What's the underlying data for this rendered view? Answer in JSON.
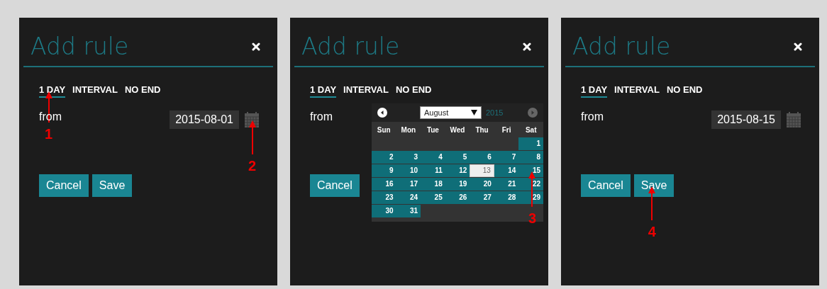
{
  "panels": [
    {
      "title": "Add rule",
      "tabs": [
        {
          "label": "1 DAY",
          "selected": true,
          "annotation": "1"
        },
        {
          "label": "INTERVAL",
          "selected": false
        },
        {
          "label": "NO END",
          "selected": false
        }
      ],
      "from_label": "from",
      "date_field": {
        "value": "2015-08-01"
      },
      "has_calendar_icon": true,
      "calendar_icon_annotation": "2",
      "buttons": [
        {
          "label": "Cancel"
        },
        {
          "label": "Save"
        }
      ]
    },
    {
      "title": "Add rule",
      "tabs": [
        {
          "label": "1 DAY",
          "selected": true
        },
        {
          "label": "INTERVAL",
          "selected": false
        },
        {
          "label": "NO END",
          "selected": false
        }
      ],
      "from_label": "from",
      "has_calendar_icon": false,
      "buttons": [
        {
          "label": "Cancel"
        }
      ],
      "datepicker": {
        "month": "August",
        "year": "2015",
        "weekdays": [
          "Sun",
          "Mon",
          "Tue",
          "Wed",
          "Thu",
          "Fri",
          "Sat"
        ],
        "weeks": [
          {
            "kind": "first",
            "days": [
              {
                "day": "1",
                "highlighted": false
              }
            ]
          },
          {
            "kind": "full",
            "days": [
              {
                "day": "2",
                "highlighted": false
              },
              {
                "day": "3",
                "highlighted": false
              },
              {
                "day": "4",
                "highlighted": false
              },
              {
                "day": "5",
                "highlighted": false
              },
              {
                "day": "6",
                "highlighted": false
              },
              {
                "day": "7",
                "highlighted": false
              },
              {
                "day": "8",
                "highlighted": false
              }
            ]
          },
          {
            "kind": "full",
            "days": [
              {
                "day": "9",
                "highlighted": false
              },
              {
                "day": "10",
                "highlighted": false
              },
              {
                "day": "11",
                "highlighted": false
              },
              {
                "day": "12",
                "highlighted": false
              },
              {
                "day": "13",
                "highlighted": true
              },
              {
                "day": "14",
                "highlighted": false
              },
              {
                "day": "15",
                "highlighted": false,
                "annotation": "3"
              }
            ]
          },
          {
            "kind": "full",
            "days": [
              {
                "day": "16",
                "highlighted": false
              },
              {
                "day": "17",
                "highlighted": false
              },
              {
                "day": "18",
                "highlighted": false
              },
              {
                "day": "19",
                "highlighted": false
              },
              {
                "day": "20",
                "highlighted": false
              },
              {
                "day": "21",
                "highlighted": false
              },
              {
                "day": "22",
                "highlighted": false
              }
            ]
          },
          {
            "kind": "full",
            "days": [
              {
                "day": "23",
                "highlighted": false
              },
              {
                "day": "24",
                "highlighted": false
              },
              {
                "day": "25",
                "highlighted": false
              },
              {
                "day": "26",
                "highlighted": false
              },
              {
                "day": "27",
                "highlighted": false
              },
              {
                "day": "28",
                "highlighted": false
              },
              {
                "day": "29",
                "highlighted": false
              }
            ]
          },
          {
            "kind": "last",
            "days": [
              {
                "day": "30",
                "highlighted": false
              },
              {
                "day": "31",
                "highlighted": false
              }
            ]
          }
        ]
      }
    },
    {
      "title": "Add rule",
      "tabs": [
        {
          "label": "1 DAY",
          "selected": true
        },
        {
          "label": "INTERVAL",
          "selected": false
        },
        {
          "label": "NO END",
          "selected": false
        }
      ],
      "from_label": "from",
      "date_field": {
        "value": "2015-08-15"
      },
      "has_calendar_icon": true,
      "buttons": [
        {
          "label": "Cancel"
        },
        {
          "label": "Save",
          "annotation": "4"
        }
      ]
    }
  ]
}
